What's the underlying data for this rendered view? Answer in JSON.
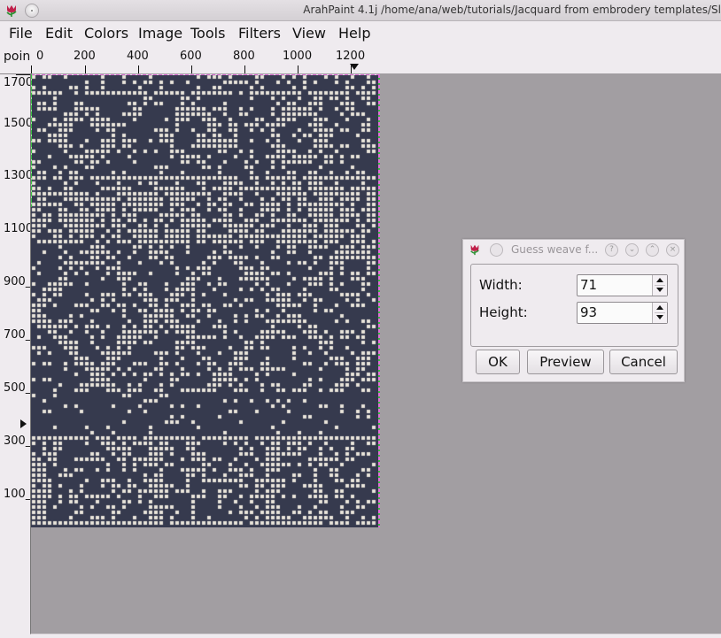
{
  "window": {
    "title": "ArahPaint 4.1j /home/ana/web/tutorials/Jacquard from embrodery templates/Sl",
    "app_icon": "tulip-icon"
  },
  "menu": [
    "File",
    "Edit",
    "Colors",
    "Image",
    "Tools",
    "Filters",
    "View",
    "Help"
  ],
  "ruler_h": {
    "unit": "poin",
    "labels": [
      "0",
      "200",
      "400",
      "600",
      "800",
      "1000",
      "1200"
    ]
  },
  "ruler_v": {
    "labels": [
      "1700",
      "1500",
      "1300",
      "1100",
      "900_",
      "700_",
      "500_",
      "300_",
      "100_"
    ]
  },
  "canvas": {
    "background_color": "#a29ea2",
    "pattern_dark": "#363a4e",
    "pattern_light": "#e8e4da"
  },
  "dialog": {
    "title": "Guess weave f...",
    "icons": [
      "help-icon",
      "minimize-icon",
      "maximize-icon",
      "close-icon"
    ],
    "width_label": "Width:",
    "width_value": "71",
    "height_label": "Height:",
    "height_value": "93",
    "ok_label": "OK",
    "preview_label": "Preview",
    "cancel_label": "Cancel"
  }
}
